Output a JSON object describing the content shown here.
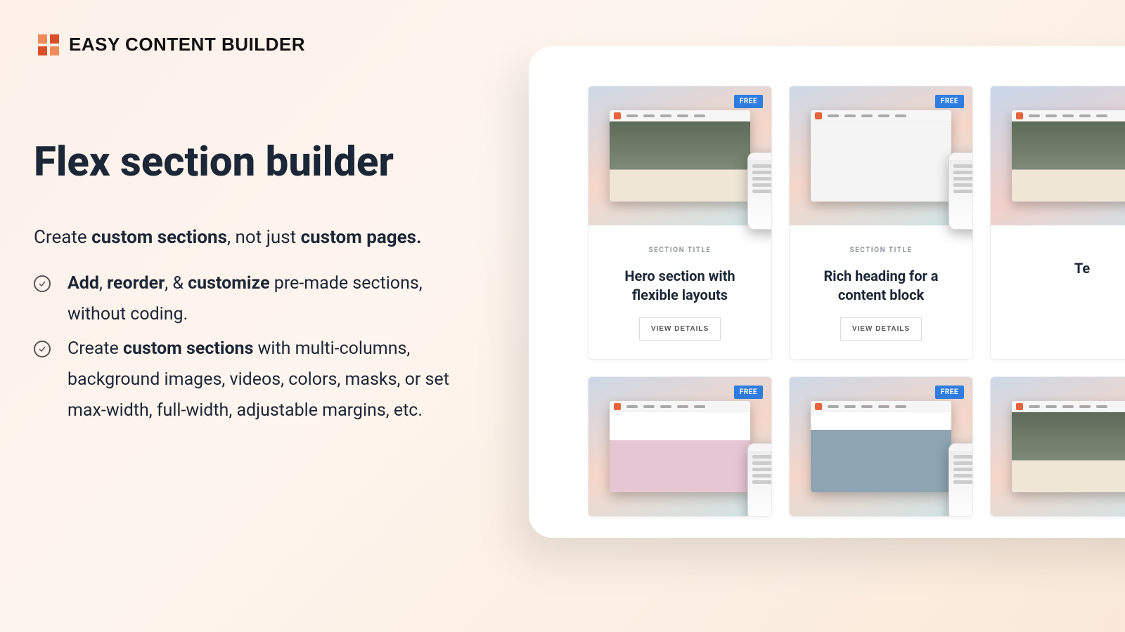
{
  "brand": {
    "name": "EASY CONTENT BUILDER"
  },
  "headline": "Flex section builder",
  "lead": {
    "prefix": "Create ",
    "bold1": "custom sections",
    "mid": ", not just ",
    "bold2": "custom pages."
  },
  "bullets": [
    {
      "parts": [
        {
          "b": "Add"
        },
        {
          "t": ", "
        },
        {
          "b": "reorder"
        },
        {
          "t": ", & "
        },
        {
          "b": "customize"
        },
        {
          "t": " pre-made sections, without coding."
        }
      ]
    },
    {
      "parts": [
        {
          "t": "Create "
        },
        {
          "b": "custom sections"
        },
        {
          "t": " with multi-columns, background images, videos, colors, masks, or set max-width, full-width, adjustable margins, etc."
        }
      ]
    }
  ],
  "gallery": {
    "overline": "SECTION TITLE",
    "view_label": "VIEW DETAILS",
    "cards": [
      {
        "badge": "FREE",
        "title": "Hero section with flexible layouts",
        "full": true,
        "variant": "v1"
      },
      {
        "badge": "FREE",
        "title": "Rich heading for a content block",
        "full": true,
        "variant": "v2"
      },
      {
        "badge": "",
        "title": "Te",
        "full": true,
        "variant": "v3",
        "partial": true
      },
      {
        "badge": "FREE",
        "title": "",
        "full": false,
        "variant": "v4"
      },
      {
        "badge": "FREE",
        "title": "",
        "full": false,
        "variant": "v5"
      },
      {
        "badge": "",
        "title": "",
        "full": false,
        "variant": "v6",
        "partial": true
      }
    ]
  }
}
